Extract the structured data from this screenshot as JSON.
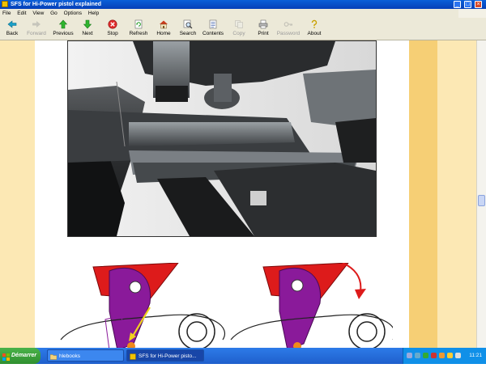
{
  "window": {
    "title": "SFS for Hi-Power pistol explained",
    "buttons": {
      "minimize": "_",
      "maximize": "□",
      "close": "×"
    }
  },
  "menubar": [
    "File",
    "Edit",
    "View",
    "Go",
    "Options",
    "Help"
  ],
  "toolbar": [
    {
      "label": "Back",
      "icon": "back-arrow-icon",
      "enabled": true
    },
    {
      "label": "Forward",
      "icon": "forward-arrow-icon",
      "enabled": false
    },
    {
      "label": "Previous",
      "icon": "up-arrow-icon",
      "enabled": true
    },
    {
      "label": "Next",
      "icon": "down-arrow-icon",
      "enabled": true
    },
    {
      "label": "Stop",
      "icon": "stop-icon",
      "enabled": true
    },
    {
      "label": "Refresh",
      "icon": "refresh-icon",
      "enabled": true
    },
    {
      "label": "Home",
      "icon": "home-icon",
      "enabled": true
    },
    {
      "label": "Search",
      "icon": "search-icon",
      "enabled": true
    },
    {
      "label": "Contents",
      "icon": "contents-icon",
      "enabled": true
    },
    {
      "label": "Copy",
      "icon": "copy-icon",
      "enabled": false
    },
    {
      "label": "Print",
      "icon": "print-icon",
      "enabled": true
    },
    {
      "label": "Password",
      "icon": "password-icon",
      "enabled": false
    },
    {
      "label": "About",
      "icon": "about-icon",
      "enabled": true
    }
  ],
  "content": {
    "photo": {
      "icon": "pistol-mechanism-photo"
    },
    "diagram": {
      "icon": "sear-mechanism-diagram",
      "colors": {
        "hammer": "#dd1b1b",
        "sear": "#8a1a9a",
        "arrow": "#f1d31e",
        "pin": "#f08a1a"
      }
    },
    "page_colors": {
      "margin": "#fce8b4",
      "stripe": "#f6cf75"
    }
  },
  "taskbar": {
    "start_label": "Démarrer",
    "tasks": [
      {
        "label": "hlebooks",
        "icon": "folder-icon",
        "active": false
      },
      {
        "label": "SFS for Hi-Power pisto...",
        "icon": "book-icon",
        "active": true
      }
    ],
    "clock": "11:21"
  }
}
